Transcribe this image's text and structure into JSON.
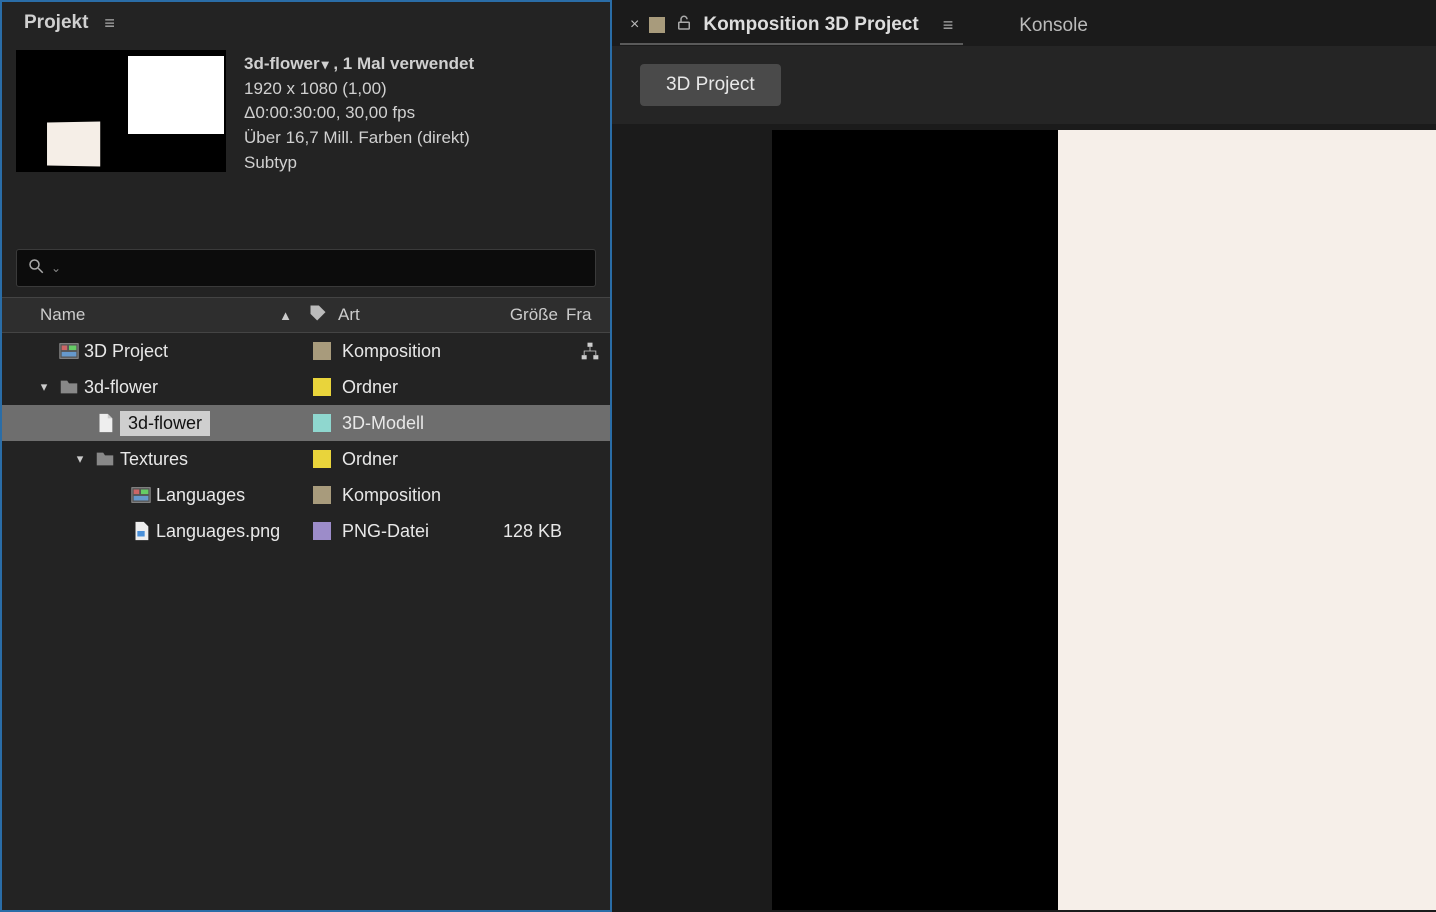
{
  "project_panel": {
    "title": "Projekt",
    "selected_item": {
      "name": "3d-flower",
      "usage": ", 1 Mal verwendet",
      "dimensions": "1920 x 1080 (1,00)",
      "duration": "Δ0:00:30:00, 30,00 fps",
      "colors": "Über 16,7 Mill. Farben (direkt)",
      "subtype": "Subtyp"
    },
    "search_placeholder": "",
    "columns": {
      "name": "Name",
      "art": "Art",
      "size": "Größe",
      "fra": "Fra"
    },
    "rows": [
      {
        "indent": 0,
        "twisty": "",
        "icon": "comp",
        "name": "3D Project",
        "label": "beige",
        "art": "Komposition",
        "size": "",
        "fra": "flowchart",
        "selected": false
      },
      {
        "indent": 0,
        "twisty": "v",
        "icon": "folder",
        "name": "3d-flower",
        "label": "yellow",
        "art": "Ordner",
        "size": "",
        "fra": "",
        "selected": false
      },
      {
        "indent": 1,
        "twisty": "",
        "icon": "file",
        "name": "3d-flower",
        "label": "cyan",
        "art": "3D-Modell",
        "size": "",
        "fra": "",
        "selected": true
      },
      {
        "indent": 1,
        "twisty": "v",
        "icon": "folder",
        "name": "Textures",
        "label": "yellow",
        "art": "Ordner",
        "size": "",
        "fra": "",
        "selected": false
      },
      {
        "indent": 2,
        "twisty": "",
        "icon": "comp",
        "name": "Languages",
        "label": "beige",
        "art": "Komposition",
        "size": "",
        "fra": "",
        "selected": false
      },
      {
        "indent": 2,
        "twisty": "",
        "icon": "png",
        "name": "Languages.png",
        "label": "purple",
        "art": "PNG-Datei",
        "size": "128 KB",
        "fra": "",
        "selected": false
      }
    ]
  },
  "composition_panel": {
    "tab_title": "Komposition 3D Project",
    "konsole": "Konsole",
    "breadcrumb": "3D Project"
  }
}
